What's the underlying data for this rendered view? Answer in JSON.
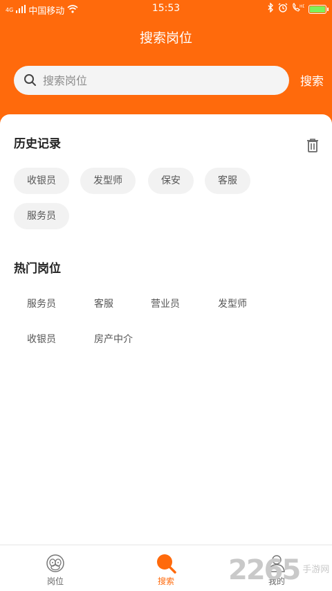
{
  "status_bar": {
    "carrier": "中国移动",
    "time": "15:53",
    "network_type": "4G",
    "battery_level": 1.0,
    "battery_color": "#7df15a"
  },
  "colors": {
    "accent": "#ff6a0c"
  },
  "header": {
    "title": "搜索岗位"
  },
  "search": {
    "placeholder": "搜索岗位",
    "button_label": "搜索"
  },
  "history": {
    "title": "历史记录",
    "items": [
      "收银员",
      "发型师",
      "保安",
      "客服",
      "服务员"
    ]
  },
  "hot": {
    "title": "热门岗位",
    "items": [
      "服务员",
      "客服",
      "营业员",
      "发型师",
      "收银员",
      "房产中介"
    ]
  },
  "tabbar": {
    "items": [
      {
        "label": "岗位",
        "icon": "monkey-face-icon",
        "active": false
      },
      {
        "label": "搜索",
        "icon": "search-icon",
        "active": true
      },
      {
        "label": "我的",
        "icon": "user-icon",
        "active": false
      }
    ]
  },
  "watermark": {
    "number": "2265",
    "text": "手游网"
  }
}
